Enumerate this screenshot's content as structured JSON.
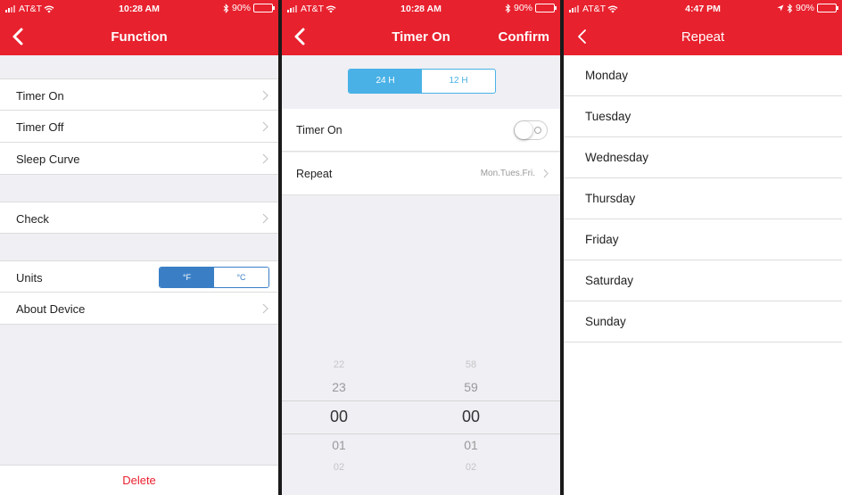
{
  "screens": [
    {
      "status": {
        "carrier": "AT&T",
        "time": "10:28 AM",
        "battery": "90%"
      },
      "nav": {
        "title": "Function"
      },
      "groups": [
        {
          "items": [
            {
              "label": "Timer On"
            },
            {
              "label": "Timer Off"
            },
            {
              "label": "Sleep Curve"
            }
          ]
        },
        {
          "items": [
            {
              "label": "Check"
            }
          ]
        },
        {
          "units": {
            "label": "Units",
            "options": [
              "°F",
              "°C"
            ],
            "selected": "°F"
          },
          "items": [
            {
              "label": "About Device"
            }
          ]
        }
      ],
      "footer": {
        "delete_label": "Delete"
      }
    },
    {
      "status": {
        "carrier": "AT&T",
        "time": "10:28 AM",
        "battery": "90%"
      },
      "nav": {
        "title": "Timer On",
        "confirm_label": "Confirm"
      },
      "hour_mode": {
        "options": [
          "24 H",
          "12 H"
        ],
        "selected": "24 H"
      },
      "timer_on": {
        "label": "Timer On",
        "enabled": false
      },
      "repeat": {
        "label": "Repeat",
        "value": "Mon.Tues.Fri."
      },
      "picker": {
        "hours": [
          "22",
          "23",
          "00",
          "01",
          "02"
        ],
        "minutes": [
          "58",
          "59",
          "00",
          "01",
          "02"
        ],
        "selected_hour": "00",
        "selected_minute": "00"
      }
    },
    {
      "status": {
        "carrier": "AT&T",
        "time": "4:47 PM",
        "battery": "90%"
      },
      "nav": {
        "title": "Repeat"
      },
      "days": [
        "Monday",
        "Tuesday",
        "Wednesday",
        "Thursday",
        "Friday",
        "Saturday",
        "Sunday"
      ]
    }
  ],
  "theme": {
    "accent": "#e8212e",
    "toggle_blue": "#3a7fc6",
    "toggle_light_blue": "#49b1e6",
    "battery": "#f5d300"
  },
  "icons": {
    "back": "chevron-left-icon",
    "disclosure": "chevron-right-icon",
    "wifi": "wifi-icon",
    "bluetooth": "bluetooth-icon",
    "location": "location-arrow-icon"
  }
}
